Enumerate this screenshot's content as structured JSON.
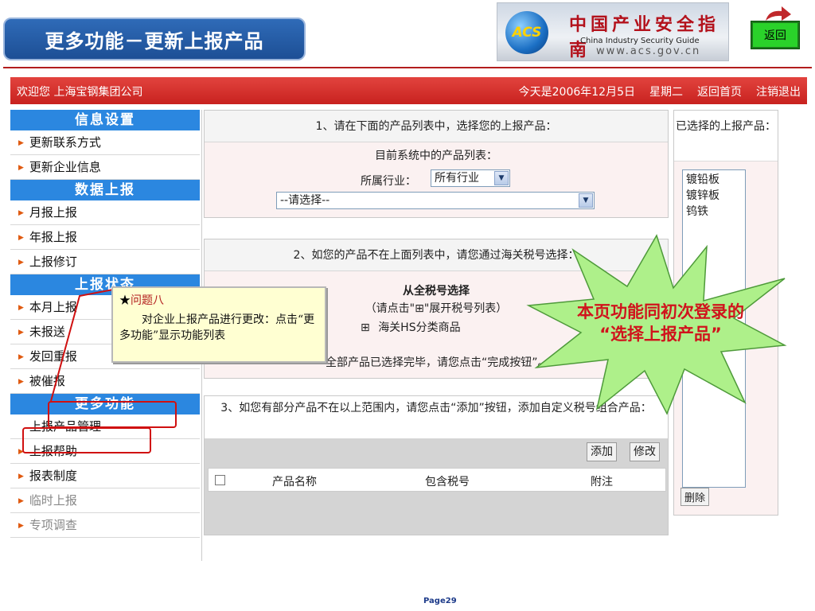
{
  "slide": {
    "title": "更多功能－更新上报产品",
    "back_button": "返回",
    "logo": {
      "mark": "ACS",
      "cn": "中国产业安全指南",
      "en": "China  Industry  Security  Guide",
      "url": "www.acs.gov.cn"
    },
    "page_label": "Page29"
  },
  "topbar": {
    "welcome": "欢迎您  上海宝钢集团公司",
    "date": "今天是2006年12月5日",
    "weekday": "星期二",
    "home_link": "返回首页",
    "logout_link": "注销退出"
  },
  "sidebar": {
    "section1": "信息设置",
    "item_contact": "更新联系方式",
    "item_company": "更新企业信息",
    "section2": "数据上报",
    "item_monthly": "月报上报",
    "item_yearly": "年报上报",
    "item_revise": "上报修订",
    "section3": "上报状态",
    "item_thismonth": "本月上报",
    "item_notsent": "未报送",
    "item_returned": "发回重报",
    "item_urged": "被催报",
    "section4": "更多功能",
    "item_product_mgmt": "上报产品管理",
    "item_help": "上报帮助",
    "item_system": "报表制度",
    "item_temp": "临时上报",
    "item_survey": "专项调查"
  },
  "panel1": {
    "heading": "1、请在下面的产品列表中，选择您的上报产品：",
    "list_label": "目前系统中的产品列表：",
    "industry_label": "所属行业：",
    "industry_value": "所有行业",
    "product_select": "--请选择--"
  },
  "panel2": {
    "heading": "2、如您的产品不在上面列表中，请您通过海关税号选择：",
    "sub_heading": "从全税号选择",
    "hint": "（请点击\"⊞\"展开税号列表）",
    "tree_item": "海关HS分类商品",
    "footer": "全部产品已选择完毕，请您点击“完成按钮”。"
  },
  "panel3": {
    "heading": "3、如您有部分产品不在以上范围内，请您点击“添加”按钮，添加自定义税号组合产品：",
    "add_button": "添加",
    "edit_button": "修改",
    "col_name": "产品名称",
    "col_code": "包含税号",
    "col_note": "附注"
  },
  "rightcol": {
    "heading": "已选择的上报产品：",
    "items": [
      "镀铅板",
      "镀锌板",
      "钨铁"
    ],
    "delete_button": "删除"
  },
  "note": {
    "star": "★",
    "title": "问题八",
    "body": "对企业上报产品进行更改：点击“更多功能”显示功能列表"
  },
  "callout": {
    "line1": "本页功能同初次登录的",
    "line2": "“选择上报产品”"
  },
  "colors": {
    "topbar_red": "#c8221f",
    "sidebar_blue": "#2b87e0",
    "highlight_red": "#d01010",
    "callout_green": "#aef08a"
  }
}
